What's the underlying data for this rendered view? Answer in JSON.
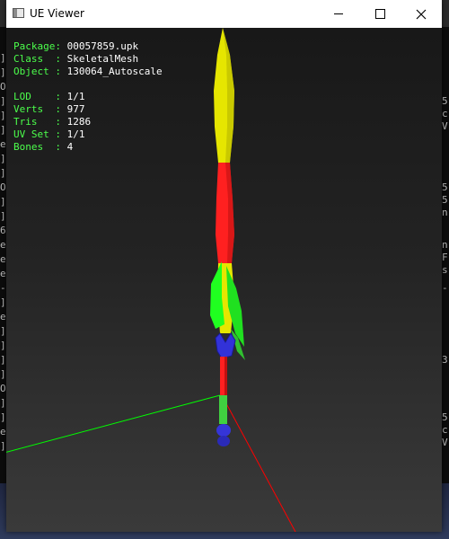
{
  "window": {
    "title": "UE Viewer",
    "minimize_label": "Minimize",
    "maximize_label": "Maximize",
    "close_label": "Close"
  },
  "info": {
    "package": {
      "key": "Package: ",
      "value": "00057859.upk"
    },
    "class": {
      "key": "Class  : ",
      "value": "SkeletalMesh"
    },
    "object": {
      "key": "Object : ",
      "value": "130064_Autoscale"
    },
    "lod": {
      "key": "LOD    : ",
      "value": "1/1"
    },
    "verts": {
      "key": "Verts  : ",
      "value": "977"
    },
    "tris": {
      "key": "Tris   : ",
      "value": "1286"
    },
    "uvset": {
      "key": "UV Set : ",
      "value": "1/1"
    },
    "bones": {
      "key": "Bones  : ",
      "value": "4"
    }
  },
  "background": {
    "left_chars": [
      "]",
      "]",
      "O",
      "]",
      "]",
      "]",
      "e",
      "]",
      "]",
      "O",
      "]",
      "]",
      "6",
      "e",
      "e",
      "e",
      "-",
      "]",
      "e",
      "]",
      "]",
      "]",
      "]",
      "O",
      "]",
      "]",
      "e",
      "]"
    ],
    "right_chars": [
      "5",
      "c",
      "V",
      "5",
      "5",
      "n",
      "n",
      "F",
      "s",
      "-",
      "3",
      "5",
      "c",
      "V"
    ]
  },
  "colors": {
    "text_green": "#4cff4c",
    "text_white": "#ffffff",
    "blade_yellow": "#e6e600",
    "blade_red": "#ff2020",
    "guard_green": "#20ff20",
    "hilt_blue": "#3030d0",
    "axis_green": "#00ff00",
    "axis_red": "#ff0000"
  }
}
